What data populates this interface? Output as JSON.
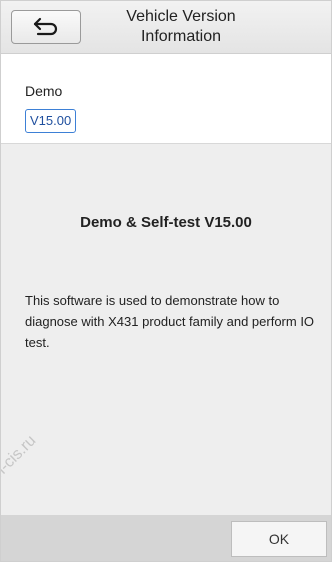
{
  "header": {
    "title_line1": "Vehicle Version",
    "title_line2": "Information",
    "back_icon": "return-arrow-icon"
  },
  "info": {
    "label": "Demo",
    "version": "V15.00"
  },
  "content": {
    "heading": "Demo & Self-test V15.00",
    "description": "This software is used to demonstrate how to diagnose with X431 product family and perform IO test."
  },
  "watermark": "n-cis.ru",
  "footer": {
    "ok_label": "OK"
  },
  "colors": {
    "accent_border": "#3d80d6",
    "content_background": "#eeeeee",
    "footer_background": "#d5d5d5"
  }
}
